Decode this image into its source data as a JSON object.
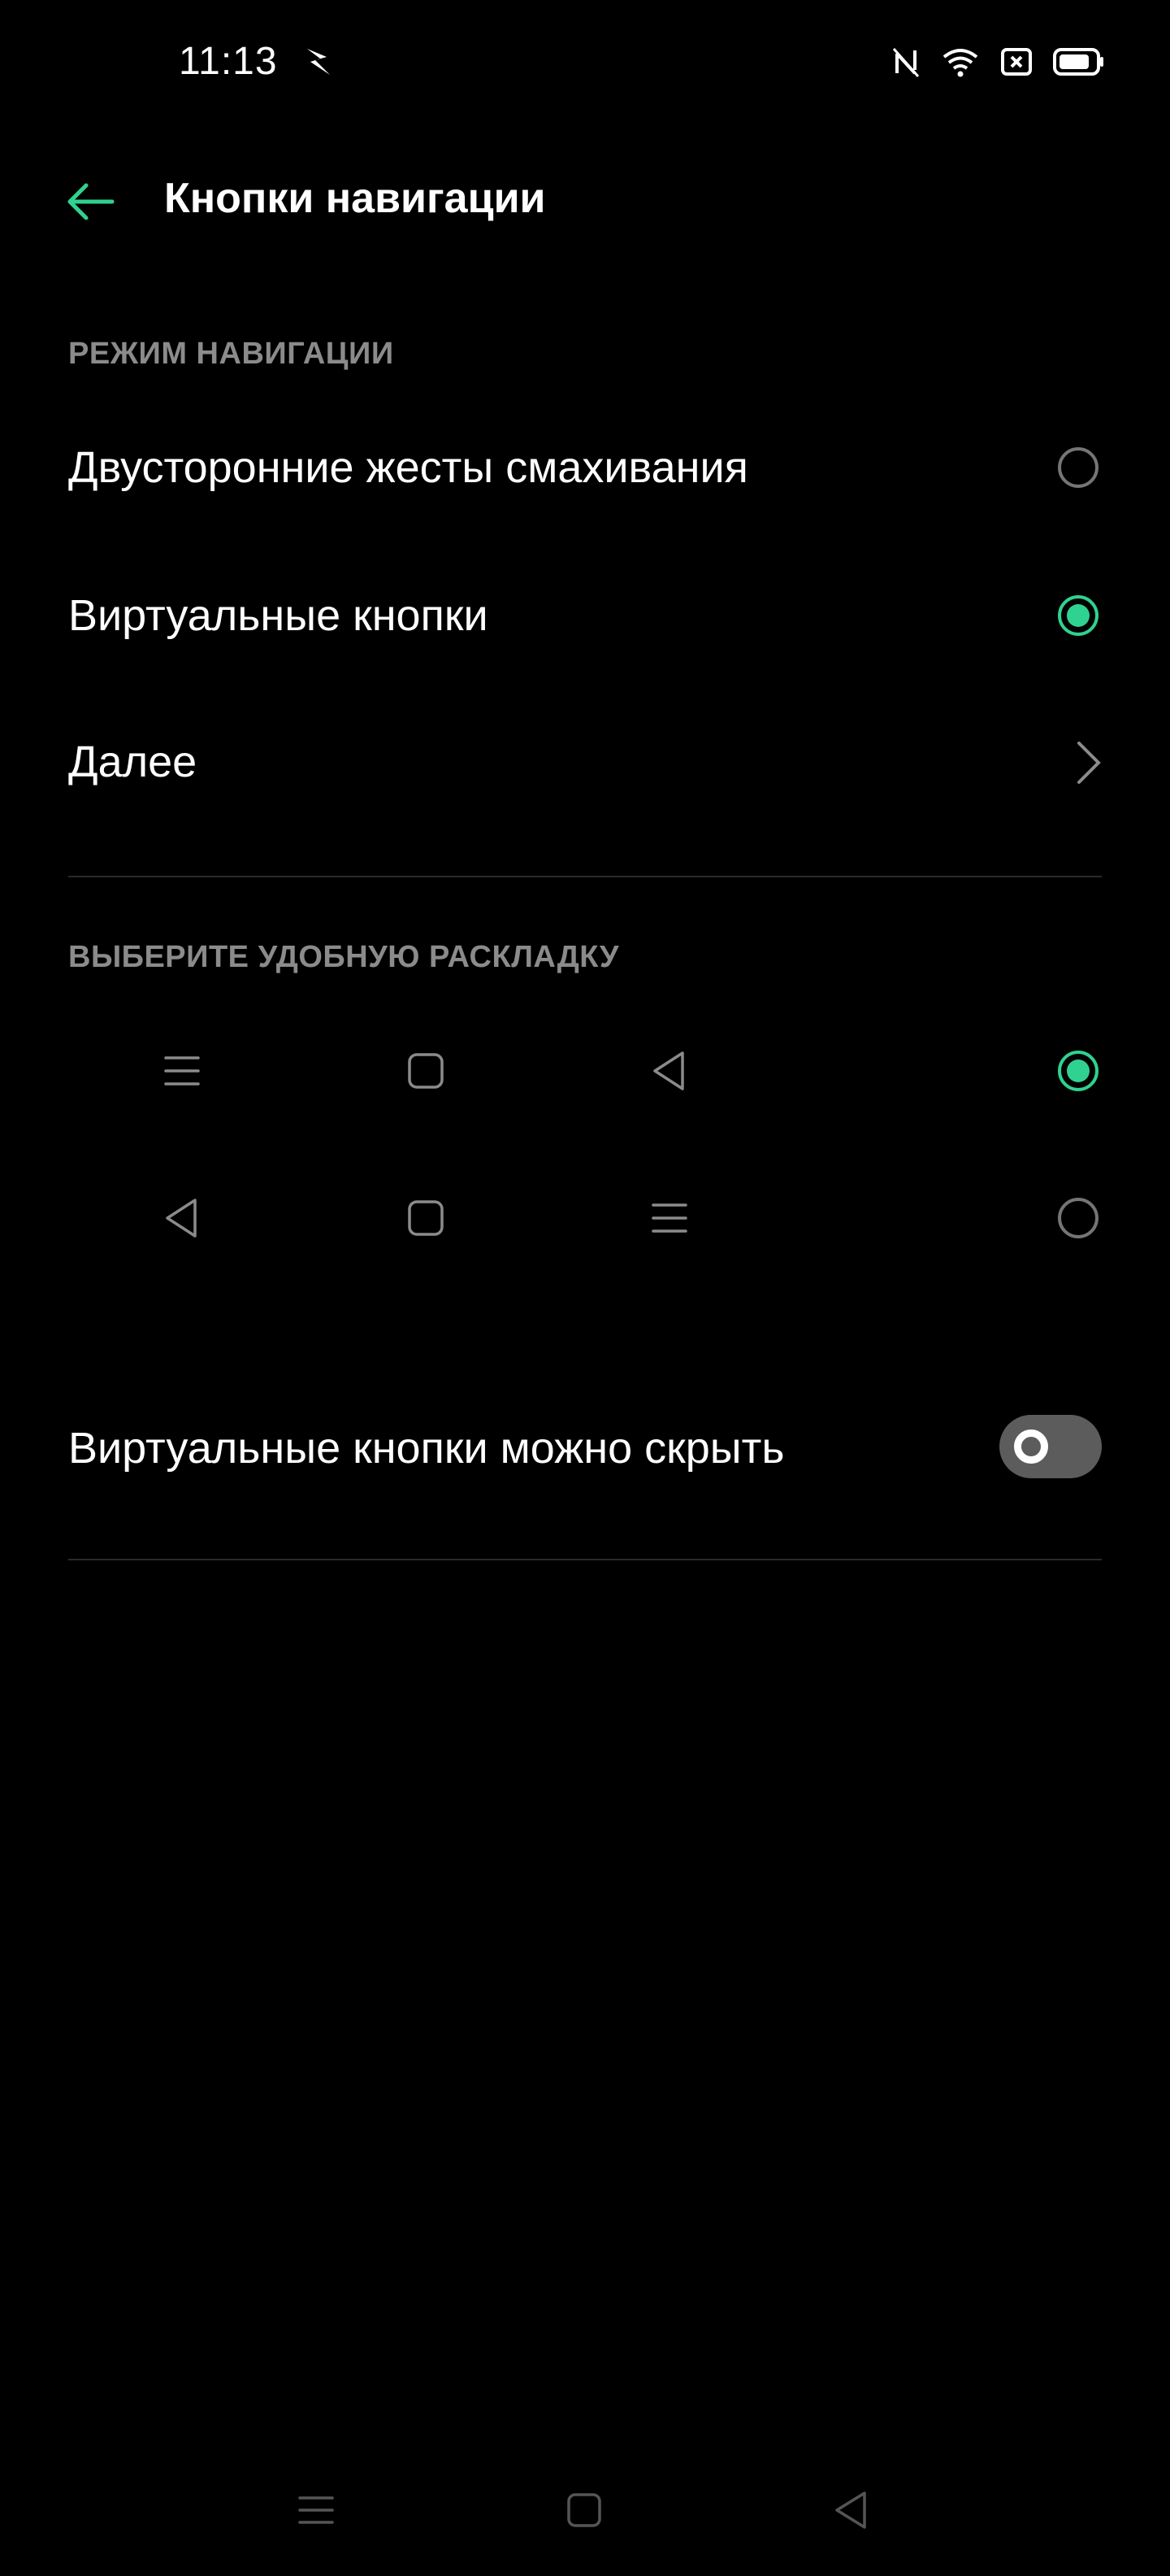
{
  "status_bar": {
    "time": "11:13",
    "icons": [
      "notification-icon",
      "nfc-icon",
      "wifi-icon",
      "sim-icon",
      "battery-icon"
    ]
  },
  "header": {
    "title": "Кнопки навигации",
    "back_icon": "back-arrow-icon"
  },
  "navigation_mode": {
    "section_title": "РЕЖИМ НАВИГАЦИИ",
    "options": [
      {
        "label": "Двусторонние жесты смахивания",
        "selected": false
      },
      {
        "label": "Виртуальные кнопки",
        "selected": true
      }
    ],
    "more_label": "Далее"
  },
  "layout": {
    "section_title": "ВЫБЕРИТЕ УДОБНУЮ РАСКЛАДКУ",
    "options": [
      {
        "icons": [
          "menu-icon",
          "home-square-icon",
          "back-triangle-icon"
        ],
        "selected": true
      },
      {
        "icons": [
          "back-triangle-icon",
          "home-square-icon",
          "menu-icon"
        ],
        "selected": false
      }
    ]
  },
  "hide_buttons": {
    "label": "Виртуальные кнопки можно скрыть",
    "enabled": false
  },
  "colors": {
    "accent": "#2fd290",
    "background": "#000000",
    "section_text": "#8b8b8b"
  }
}
